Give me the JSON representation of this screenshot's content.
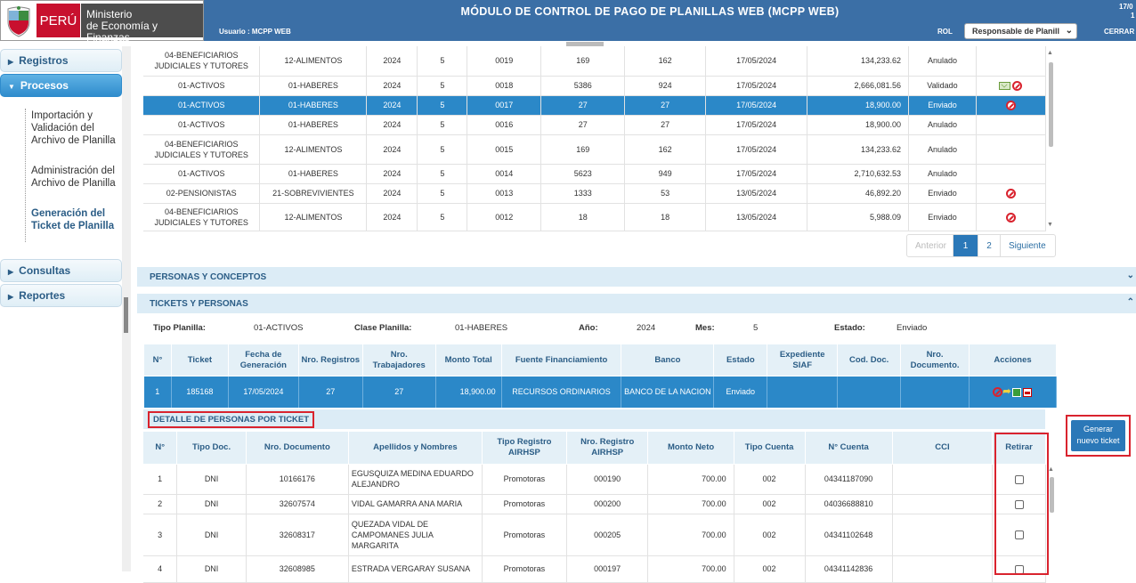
{
  "header": {
    "logo": {
      "country": "PERÚ",
      "ministry_line1": "Ministerio",
      "ministry_line2": "de Economía y Finanzas"
    },
    "title": "MÓDULO DE CONTROL DE PAGO DE PLANILLAS WEB (MCPP WEB)",
    "user_label": "Usuario : MCPP WEB",
    "rol_label": "ROL",
    "rol_value": "Responsable de Planill",
    "logout_label": "CERRAR",
    "date_partial": "17/0",
    "date_partial2": "1"
  },
  "sidebar": {
    "items": [
      {
        "label": "Registros",
        "arrow": "▶"
      },
      {
        "label": "Procesos",
        "arrow": "▼"
      },
      {
        "label": "Consultas",
        "arrow": "▶"
      },
      {
        "label": "Reportes",
        "arrow": "▶"
      }
    ],
    "sub_items": [
      {
        "label": "Importación y Validación del Archivo de Planilla"
      },
      {
        "label": "Administración del Archivo de Planilla"
      },
      {
        "label": "Generación del Ticket de Planilla"
      }
    ]
  },
  "planillas": {
    "rows": [
      {
        "tipo": "04-BENEFICIARIOS JUDICIALES Y TUTORES",
        "clase": "12-ALIMENTOS",
        "anio": "2024",
        "mes": "5",
        "corr": "0019",
        "registros": "169",
        "trabajadores": "162",
        "fecha": "17/05/2024",
        "monto": "134,233.62",
        "estado": "Anulado",
        "acciones": ""
      },
      {
        "tipo": "01-ACTIVOS",
        "clase": "01-HABERES",
        "anio": "2024",
        "mes": "5",
        "corr": "0018",
        "registros": "5386",
        "trabajadores": "924",
        "fecha": "17/05/2024",
        "monto": "2,666,081.56",
        "estado": "Validado",
        "acciones": "mail-ban"
      },
      {
        "tipo": "01-ACTIVOS",
        "clase": "01-HABERES",
        "anio": "2024",
        "mes": "5",
        "corr": "0017",
        "registros": "27",
        "trabajadores": "27",
        "fecha": "17/05/2024",
        "monto": "18,900.00",
        "estado": "Enviado",
        "acciones": "ban"
      },
      {
        "tipo": "01-ACTIVOS",
        "clase": "01-HABERES",
        "anio": "2024",
        "mes": "5",
        "corr": "0016",
        "registros": "27",
        "trabajadores": "27",
        "fecha": "17/05/2024",
        "monto": "18,900.00",
        "estado": "Anulado",
        "acciones": ""
      },
      {
        "tipo": "04-BENEFICIARIOS JUDICIALES Y TUTORES",
        "clase": "12-ALIMENTOS",
        "anio": "2024",
        "mes": "5",
        "corr": "0015",
        "registros": "169",
        "trabajadores": "162",
        "fecha": "17/05/2024",
        "monto": "134,233.62",
        "estado": "Anulado",
        "acciones": ""
      },
      {
        "tipo": "01-ACTIVOS",
        "clase": "01-HABERES",
        "anio": "2024",
        "mes": "5",
        "corr": "0014",
        "registros": "5623",
        "trabajadores": "949",
        "fecha": "17/05/2024",
        "monto": "2,710,632.53",
        "estado": "Anulado",
        "acciones": ""
      },
      {
        "tipo": "02-PENSIONISTAS",
        "clase": "21-SOBREVIVIENTES",
        "anio": "2024",
        "mes": "5",
        "corr": "0013",
        "registros": "1333",
        "trabajadores": "53",
        "fecha": "13/05/2024",
        "monto": "46,892.20",
        "estado": "Enviado",
        "acciones": "ban"
      },
      {
        "tipo": "04-BENEFICIARIOS JUDICIALES Y TUTORES",
        "clase": "12-ALIMENTOS",
        "anio": "2024",
        "mes": "5",
        "corr": "0012",
        "registros": "18",
        "trabajadores": "18",
        "fecha": "13/05/2024",
        "monto": "5,988.09",
        "estado": "Enviado",
        "acciones": "ban"
      }
    ],
    "selected_index": 2,
    "pagination": {
      "prev": "Anterior",
      "pages": [
        "1",
        "2"
      ],
      "current": "1",
      "next": "Siguiente"
    }
  },
  "panels": {
    "personas_conceptos": "PERSONAS Y CONCEPTOS",
    "tickets_personas": "TICKETS Y PERSONAS"
  },
  "ticket_info": {
    "tipo_label": "Tipo Planilla:",
    "tipo_value": "01-ACTIVOS",
    "clase_label": "Clase Planilla:",
    "clase_value": "01-HABERES",
    "anio_label": "Año:",
    "anio_value": "2024",
    "mes_label": "Mes:",
    "mes_value": "5",
    "estado_label": "Estado:",
    "estado_value": "Enviado"
  },
  "tickets": {
    "headers": [
      "N°",
      "Ticket",
      "Fecha de Generación",
      "Nro. Registros",
      "Nro. Trabajadores",
      "Monto Total",
      "Fuente Financiamiento",
      "Banco",
      "Estado",
      "Expediente SIAF",
      "Cod. Doc.",
      "Nro. Documento.",
      "Acciones"
    ],
    "rows": [
      {
        "n": "1",
        "ticket": "185168",
        "fecha": "17/05/2024",
        "registros": "27",
        "trabajadores": "27",
        "monto": "18,900.00",
        "fuente": "RECURSOS ORDINARIOS",
        "banco": "BANCO DE LA NACION",
        "estado": "Enviado",
        "expediente": "",
        "cod_doc": "",
        "nro_doc": ""
      }
    ]
  },
  "detalle": {
    "title": "DETALLE DE PERSONAS POR TICKET",
    "headers": [
      "N°",
      "Tipo Doc.",
      "Nro. Documento",
      "Apellidos y Nombres",
      "Tipo Registro AIRHSP",
      "Nro. Registro AIRHSP",
      "Monto Neto",
      "Tipo Cuenta",
      "N° Cuenta",
      "CCI",
      "Retirar"
    ],
    "rows": [
      {
        "n": "1",
        "tipo_doc": "DNI",
        "nro_doc": "10166176",
        "nombre": "EGUSQUIZA MEDINA EDUARDO ALEJANDRO",
        "tipo_reg": "Promotoras",
        "nro_reg": "000190",
        "monto": "700.00",
        "tipo_cta": "002",
        "cuenta": "04341187090",
        "cci": ""
      },
      {
        "n": "2",
        "tipo_doc": "DNI",
        "nro_doc": "32607574",
        "nombre": "VIDAL GAMARRA ANA MARIA",
        "tipo_reg": "Promotoras",
        "nro_reg": "000200",
        "monto": "700.00",
        "tipo_cta": "002",
        "cuenta": "04036688810",
        "cci": ""
      },
      {
        "n": "3",
        "tipo_doc": "DNI",
        "nro_doc": "32608317",
        "nombre": "QUEZADA VIDAL DE CAMPOMANES JULIA MARGARITA",
        "tipo_reg": "Promotoras",
        "nro_reg": "000205",
        "monto": "700.00",
        "tipo_cta": "002",
        "cuenta": "04341102648",
        "cci": ""
      },
      {
        "n": "4",
        "tipo_doc": "DNI",
        "nro_doc": "32608985",
        "nombre": "ESTRADA VERGARAY SUSANA",
        "tipo_reg": "Promotoras",
        "nro_reg": "000197",
        "monto": "700.00",
        "tipo_cta": "002",
        "cuenta": "04341142836",
        "cci": ""
      }
    ]
  },
  "generate_button": {
    "line1": "Generar",
    "line2": "nuevo ticket"
  }
}
